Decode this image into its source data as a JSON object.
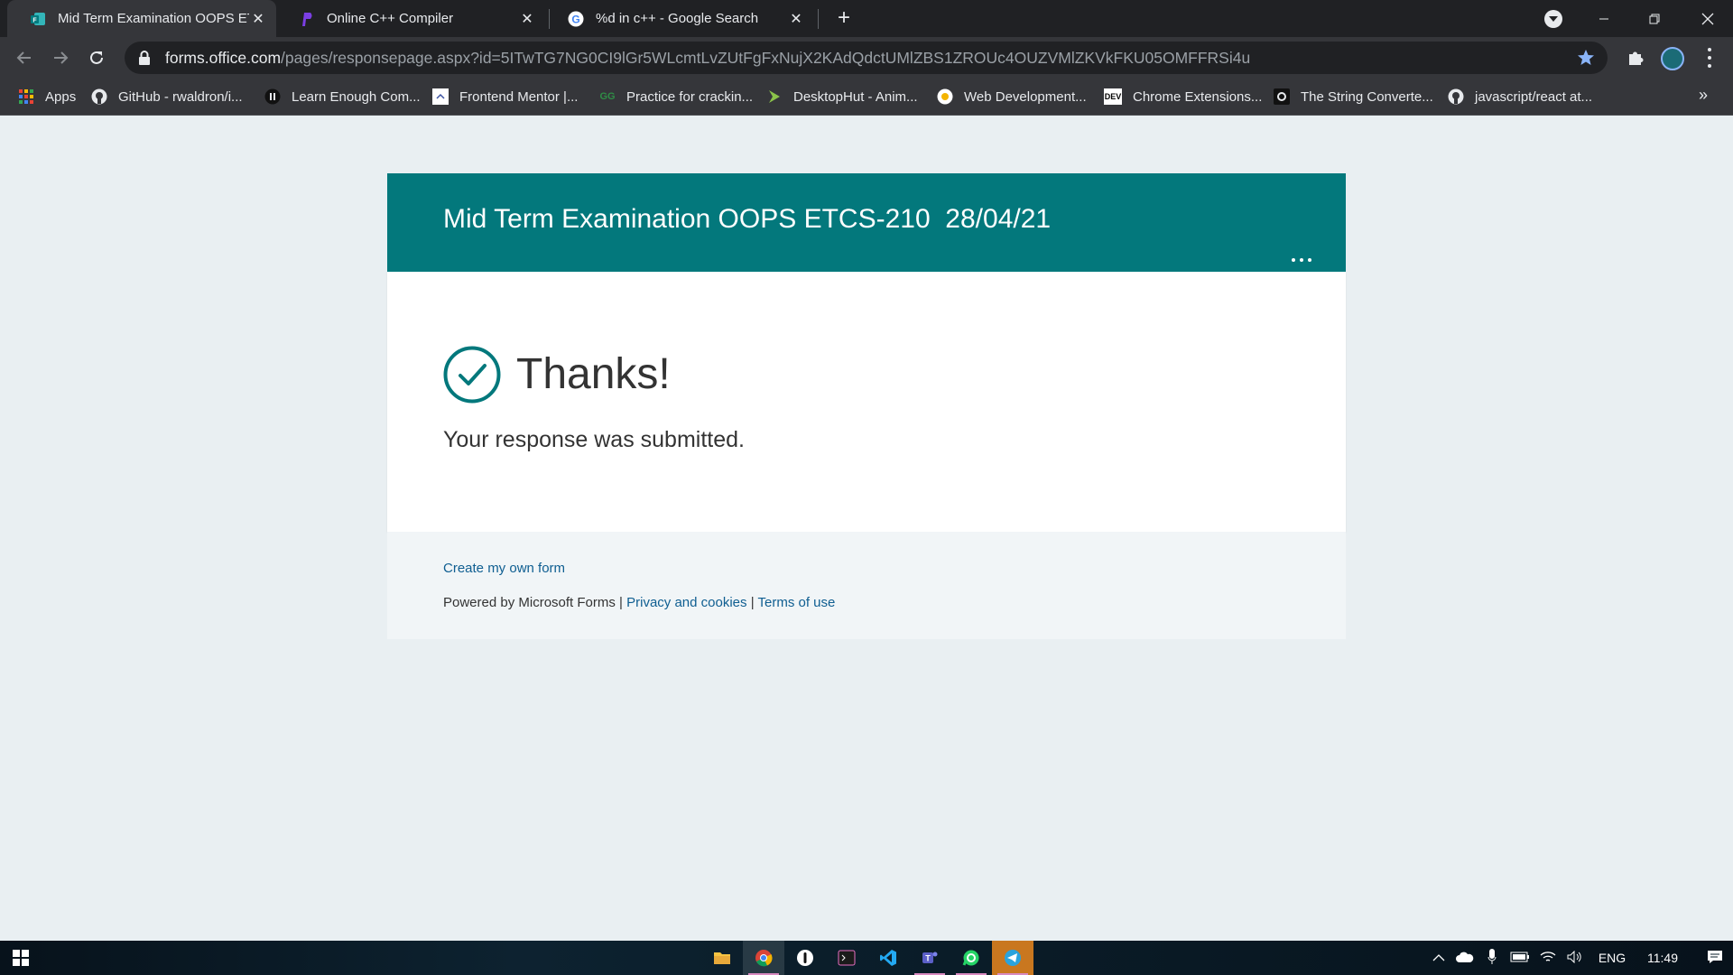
{
  "browser": {
    "tabs": [
      {
        "title": "Mid Term Examination OOPS ETC",
        "icon": "microsoft-forms-icon",
        "active": true
      },
      {
        "title": "Online C++ Compiler",
        "icon": "compiler-logo-icon",
        "active": false
      },
      {
        "title": "%d in c++ - Google Search",
        "icon": "google-icon",
        "active": false
      }
    ],
    "new_tab_label": "+",
    "url_host": "forms.office.com",
    "url_path": "/pages/responsepage.aspx?id=5ITwTG7NG0CI9lGr5WLcmtLvZUtFgFxNujX2KAdQdctUMlZBS1ZROUc4OUZVMlZKVkFKU05OMFFRSi4u"
  },
  "bookmarks": [
    {
      "label": "Apps",
      "icon": "apps-grid-icon"
    },
    {
      "label": "GitHub - rwaldron/i...",
      "icon": "github-icon"
    },
    {
      "label": "Learn Enough Com...",
      "icon": "learn-enough-icon"
    },
    {
      "label": "Frontend Mentor |...",
      "icon": "frontend-mentor-icon"
    },
    {
      "label": "Practice for crackin...",
      "icon": "geeksforgeeks-icon"
    },
    {
      "label": "DesktopHut - Anim...",
      "icon": "desktophut-icon"
    },
    {
      "label": "Web Development...",
      "icon": "web-dev-icon"
    },
    {
      "label": "Chrome Extensions...",
      "icon": "dev-icon"
    },
    {
      "label": "The String Converte...",
      "icon": "string-converter-icon"
    },
    {
      "label": "javascript/react at...",
      "icon": "github-icon"
    }
  ],
  "bookmarks_more": "»",
  "form": {
    "title": "Mid Term Examination OOPS ETCS-210  28/04/21",
    "thanks": "Thanks!",
    "message": "Your response was submitted.",
    "create_link": "Create my own form",
    "powered_by": "Powered by Microsoft Forms | ",
    "privacy_link": "Privacy and cookies",
    "separator": " | ",
    "terms_link": "Terms of use"
  },
  "colors": {
    "header": "#03787c",
    "link": "#0f5e91",
    "page_bg": "#e9eff2"
  },
  "taskbar": {
    "apps": [
      "file-explorer-icon",
      "chrome-icon",
      "app-icon",
      "terminal-icon",
      "vscode-icon",
      "teams-icon",
      "whatsapp-icon",
      "telegram-icon"
    ],
    "language": "ENG",
    "time": "11:49"
  }
}
